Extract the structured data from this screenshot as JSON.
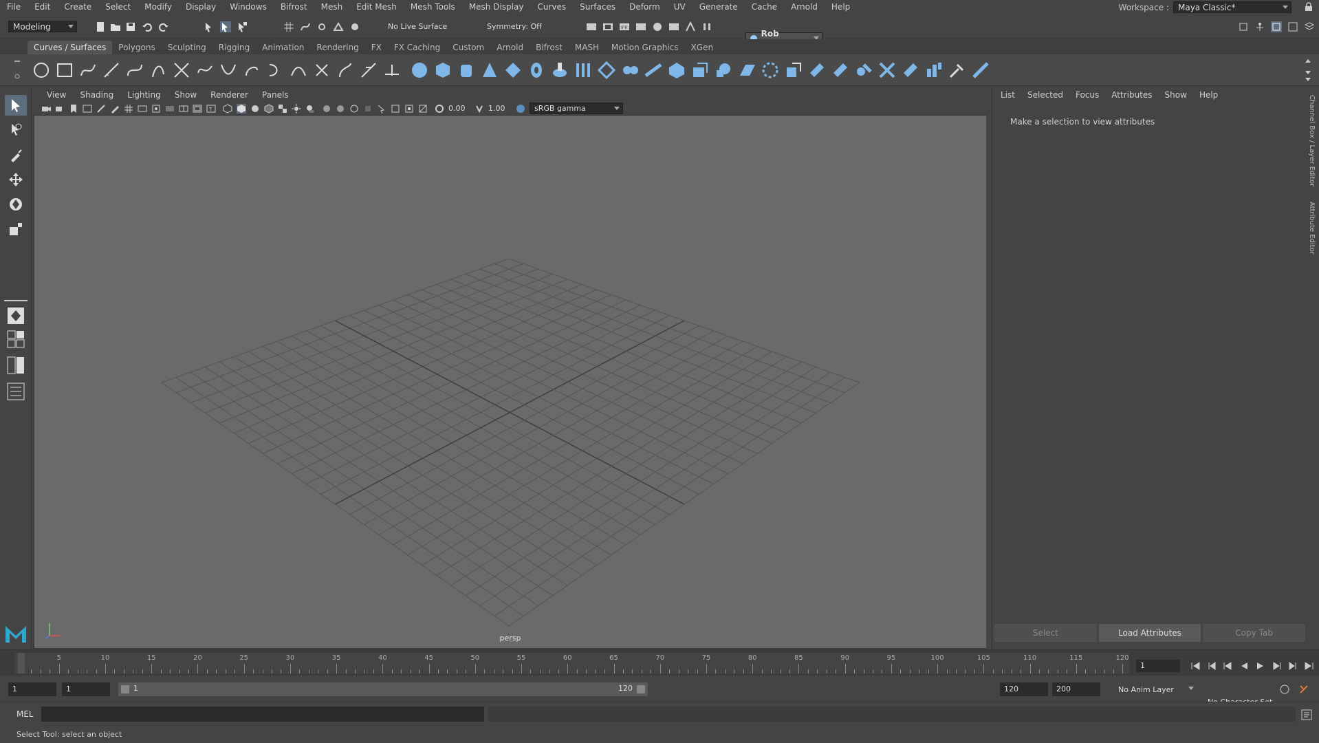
{
  "menubar": {
    "items": [
      "File",
      "Edit",
      "Create",
      "Select",
      "Modify",
      "Display",
      "Windows",
      "Bifrost",
      "Mesh",
      "Edit Mesh",
      "Mesh Tools",
      "Mesh Display",
      "Curves",
      "Surfaces",
      "Deform",
      "UV",
      "Generate",
      "Cache",
      "Arnold",
      "Help"
    ],
    "workspace_label": "Workspace :",
    "workspace_value": "Maya Classic*"
  },
  "statusline": {
    "mode": "Modeling",
    "live_surface": "No Live Surface",
    "symmetry": "Symmetry: Off",
    "user": "Rob Redman"
  },
  "shelf": {
    "tabs": [
      "Curves / Surfaces",
      "Polygons",
      "Sculpting",
      "Rigging",
      "Animation",
      "Rendering",
      "FX",
      "FX Caching",
      "Custom",
      "Arnold",
      "Bifrost",
      "MASH",
      "Motion Graphics",
      "XGen"
    ],
    "active_tab": "Curves / Surfaces"
  },
  "panel": {
    "menu": [
      "View",
      "Shading",
      "Lighting",
      "Show",
      "Renderer",
      "Panels"
    ],
    "exposure": "0.00",
    "gamma": "1.00",
    "color_space": "sRGB gamma",
    "camera_label": "persp"
  },
  "attribute_editor": {
    "menu": [
      "List",
      "Selected",
      "Focus",
      "Attributes",
      "Show",
      "Help"
    ],
    "message": "Make a selection to view attributes",
    "buttons": [
      "Select",
      "Load Attributes",
      "Copy Tab"
    ]
  },
  "side_tabs": [
    "Channel Box / Layer Editor",
    "Attribute Editor"
  ],
  "timeline": {
    "labels": [
      "1",
      "5",
      "10",
      "15",
      "20",
      "25",
      "30",
      "35",
      "40",
      "45",
      "50",
      "55",
      "60",
      "65",
      "70",
      "75",
      "80",
      "85",
      "90",
      "95",
      "100",
      "105",
      "110",
      "115",
      "120"
    ],
    "current_frame": "1"
  },
  "range": {
    "start": "1",
    "playback_start": "1",
    "slider_start": "1",
    "slider_end": "120",
    "playback_end": "120",
    "end": "200",
    "anim_layer": "No Anim Layer",
    "character_set": "No Character Set"
  },
  "cmdline": {
    "language": "MEL"
  },
  "helpline": {
    "text": "Select Tool: select an object"
  },
  "colors": {
    "background": "#444444",
    "viewport": "#6a6a6a",
    "grid": "#555555",
    "accent": "#5d6d7e"
  }
}
